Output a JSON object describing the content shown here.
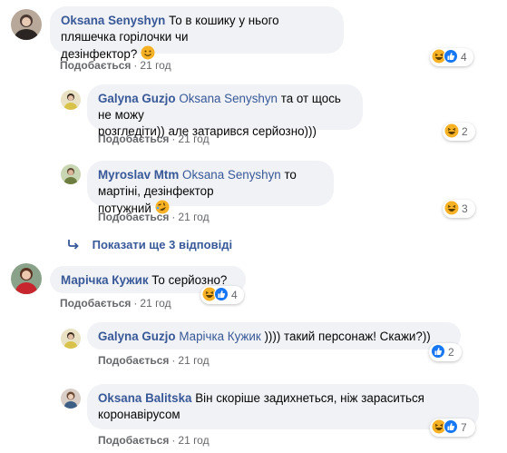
{
  "comments": [
    {
      "author": "Oksana Senyshyn",
      "text_line1": "То в кошику у нього пляшечка горілочки чи",
      "text_line2": "дезінфектор?",
      "like": "Подобається",
      "sep": "·",
      "time": "21 год",
      "reaction_count": "4",
      "reaction_icons": [
        "haha-icon",
        "like-icon"
      ]
    },
    {
      "author": "Galyna Guzjo",
      "mention": "Oksana Senyshyn",
      "text_line1": "та от щось не можу",
      "text_line2": "розгледіти)) але затарився серйозно)))",
      "like": "Подобається",
      "sep": "·",
      "time": "21 год",
      "reaction_count": "2",
      "reaction_icons": [
        "haha-icon"
      ]
    },
    {
      "author": "Myroslav Mtm",
      "mention": "Oksana Senyshyn",
      "text_line1": "то мартіні, дезінфектор",
      "text_line2": "потужний",
      "like": "Подобається",
      "sep": "·",
      "time": "21 год",
      "reaction_count": "3",
      "reaction_icons": [
        "haha-icon"
      ]
    },
    {
      "author": "Марічка Кужик",
      "text_line1": "То серйозно?",
      "like": "Подобається",
      "sep": "·",
      "time": "21 год",
      "reaction_count": "4",
      "reaction_icons": [
        "haha-icon",
        "like-icon"
      ]
    },
    {
      "author": "Galyna Guzjo",
      "mention": "Марічка Кужик",
      "text_line1": ")))) такий персонаж! Скажи?))",
      "like": "Подобається",
      "sep": "·",
      "time": "21 год",
      "reaction_count": "2",
      "reaction_icons": [
        "like-icon"
      ]
    },
    {
      "author": "Oksana Balitska",
      "text_line1": "Він скоріше задихнеться, ніж зараситься",
      "text_line2": "коронавірусом",
      "like": "Подобається",
      "sep": "·",
      "time": "21 год",
      "reaction_count": "7",
      "reaction_icons": [
        "haha-icon",
        "like-icon"
      ]
    }
  ],
  "show_more_replies": "Показати ще 3 відповіді",
  "colors": {
    "bubble": "#f0f2f5",
    "name": "#385898",
    "meta": "#65676b",
    "like": "#1877f2",
    "haha": "#f7b125"
  }
}
